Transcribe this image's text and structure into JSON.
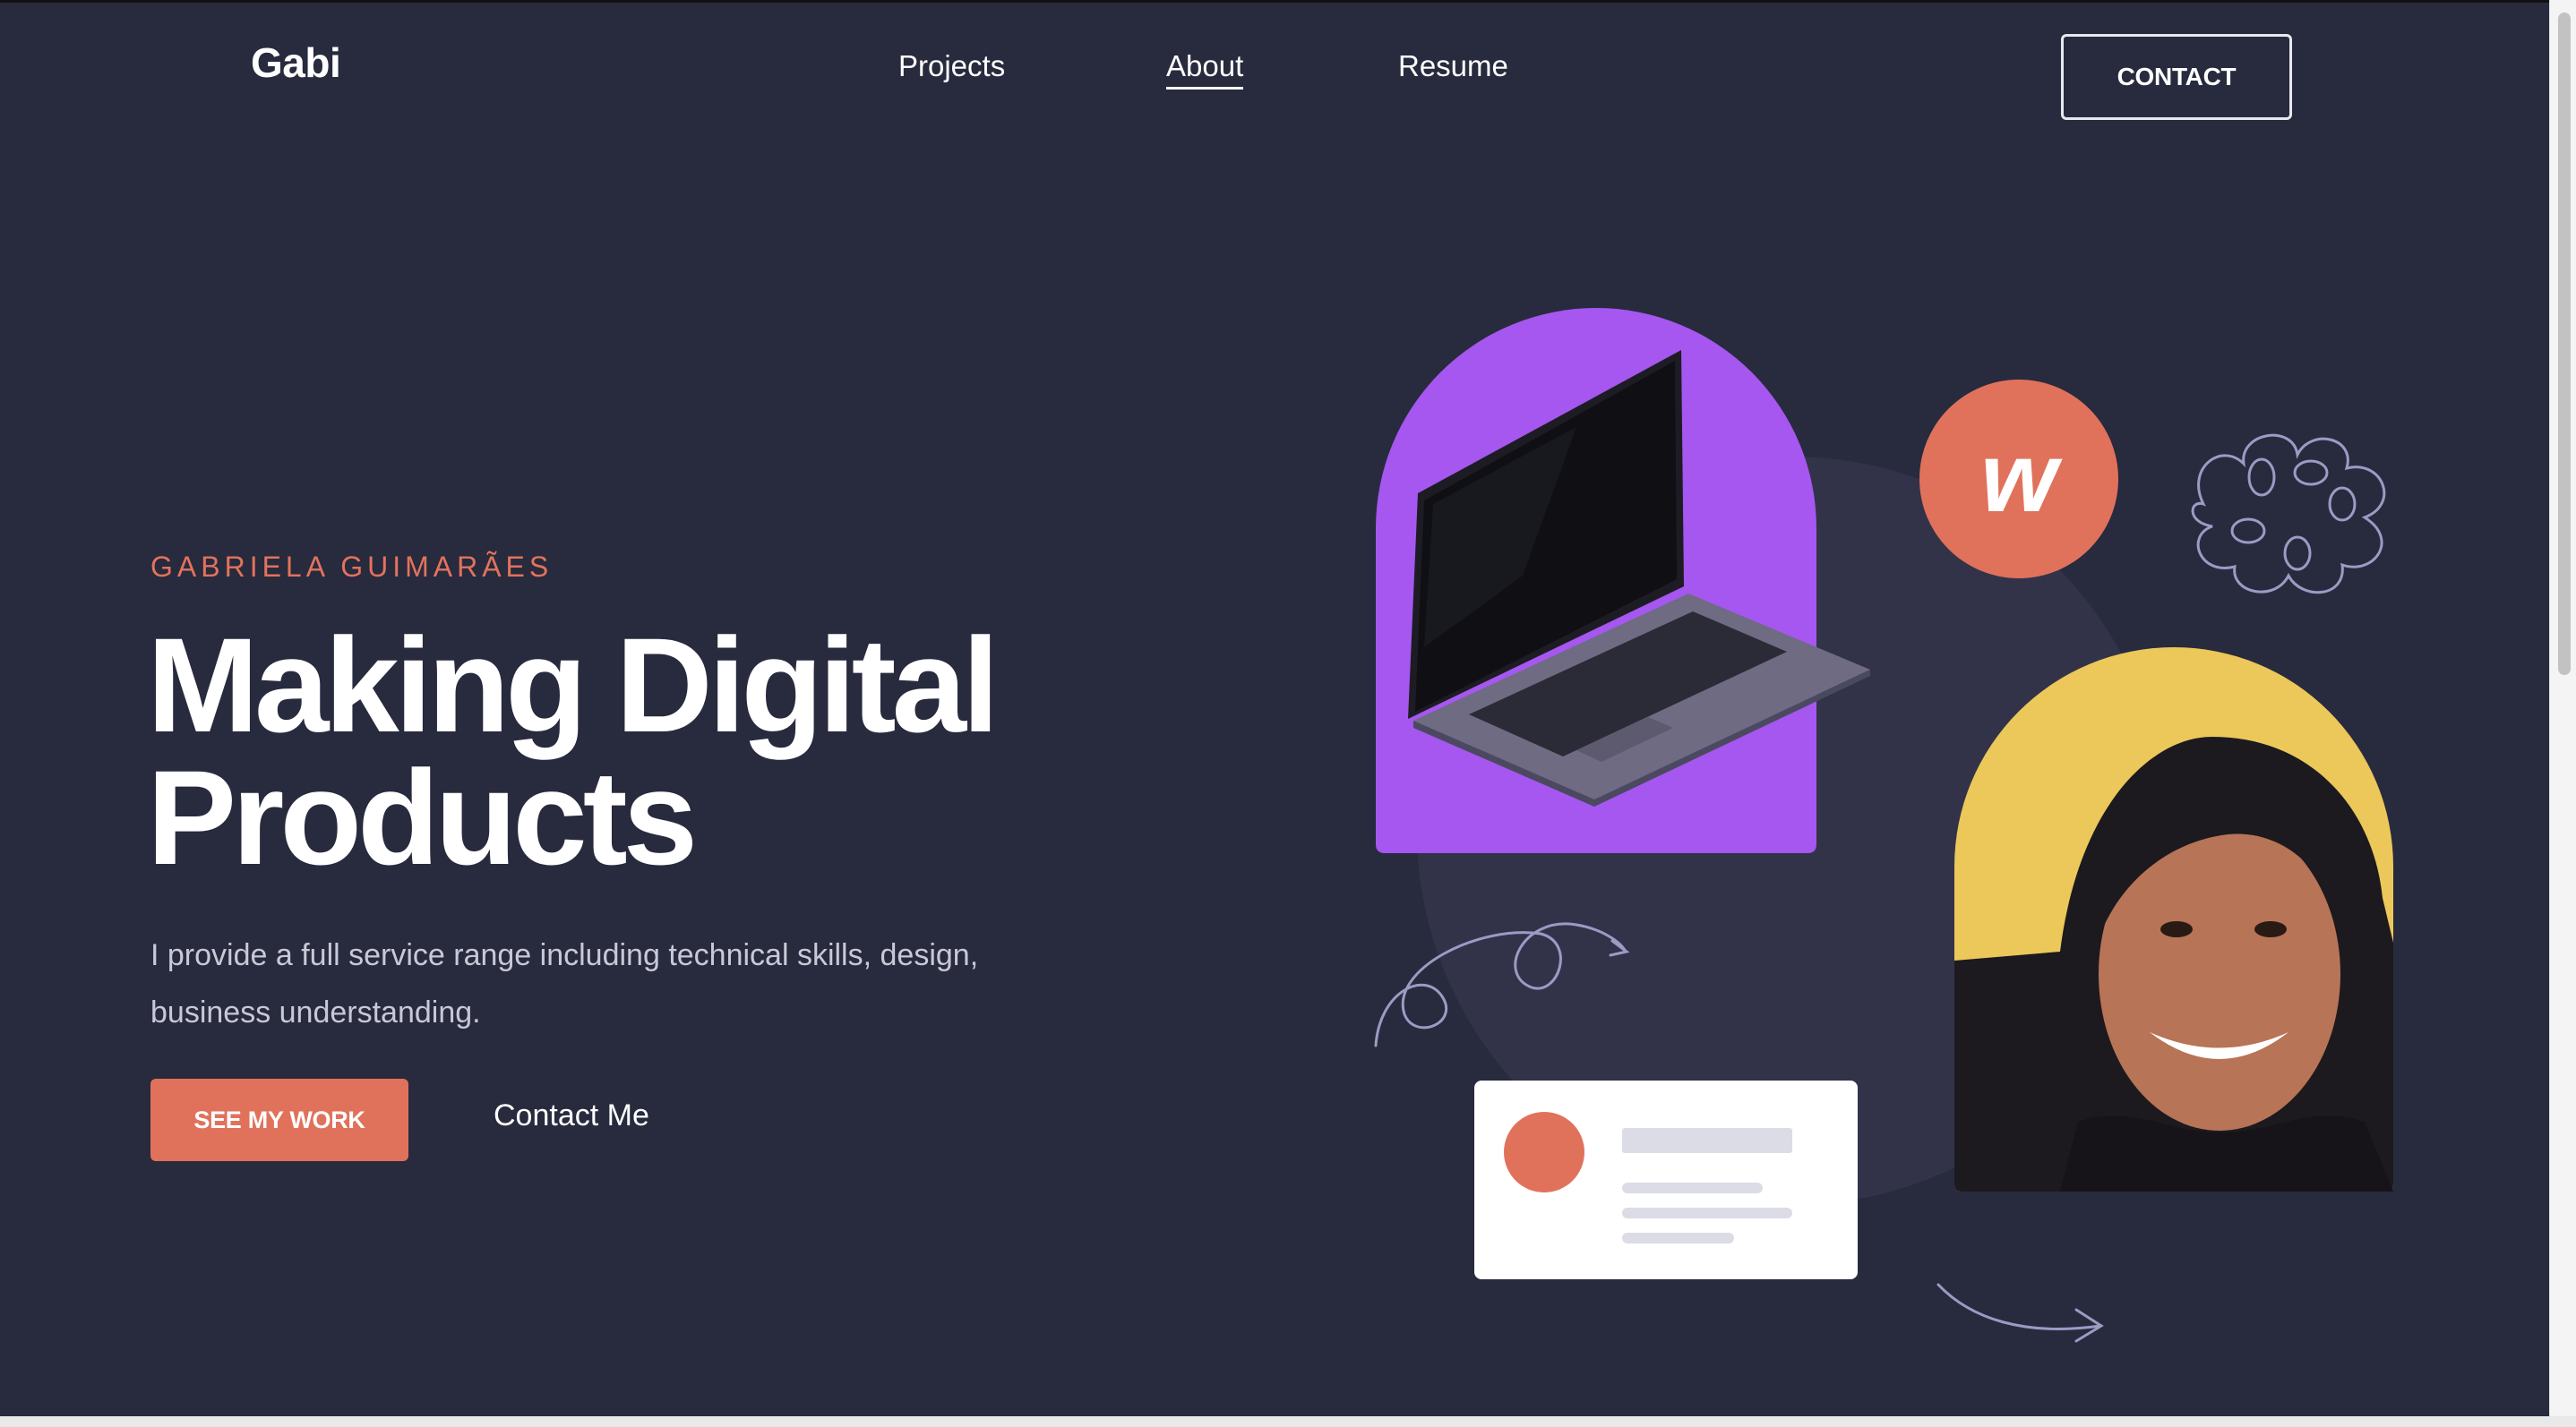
{
  "header": {
    "logo": "Gabi",
    "nav": [
      {
        "label": "Projects",
        "active": false
      },
      {
        "label": "About",
        "active": true
      },
      {
        "label": "Resume",
        "active": false
      }
    ],
    "contact_label": "CONTACT"
  },
  "hero": {
    "eyebrow": "GABRIELA GUIMARÃES",
    "headline_line1": "Making Digital",
    "headline_line2": "Products",
    "lead": "I provide a full service range including technical skills, design, business understanding.",
    "primary_button": "SEE MY WORK",
    "secondary_link": "Contact Me"
  },
  "illustration": {
    "badge_letter": "w",
    "colors": {
      "background": "#282a3e",
      "accent": "#e0725c",
      "purple_arch": "#a557ef",
      "yellow_arch": "#ecc85a",
      "circle_bg": "#323349",
      "doodle": "#9d9ac4"
    }
  }
}
